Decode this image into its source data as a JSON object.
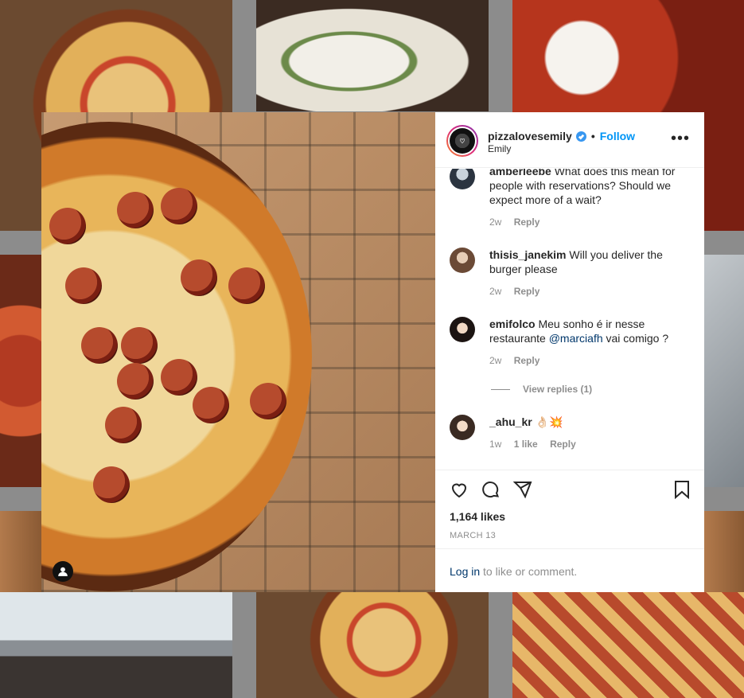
{
  "post": {
    "username": "pizzalovesemily",
    "separator": "•",
    "follow_label": "Follow",
    "subtitle": "Emily",
    "more_label": "•••"
  },
  "comments": [
    {
      "username": "amberleebe",
      "text": "What does this mean for people with reservations? Should we expect more of a wait?",
      "time": "2w",
      "reply_label": "Reply"
    },
    {
      "username": "thisis_janekim",
      "text": "Will you deliver the burger please",
      "time": "2w",
      "reply_label": "Reply"
    },
    {
      "username": "emifolco",
      "text_before": "Meu sonho é ir nesse restaurante",
      "mention": "@marciafh",
      "text_after": "vai comigo ?",
      "time": "2w",
      "reply_label": "Reply"
    },
    {
      "username": "_ahu_kr",
      "text": "👌🏻💥",
      "time": "1w",
      "likes": "1 like",
      "reply_label": "Reply"
    }
  ],
  "view_replies": "View replies (1)",
  "likes": "1,164 likes",
  "date": "MARCH 13",
  "login": {
    "link": "Log in",
    "rest": " to like or comment."
  },
  "colors": {
    "follow": "#0095f6",
    "verified": "#3897f0",
    "text": "#262626",
    "muted": "#8e8e8e"
  }
}
